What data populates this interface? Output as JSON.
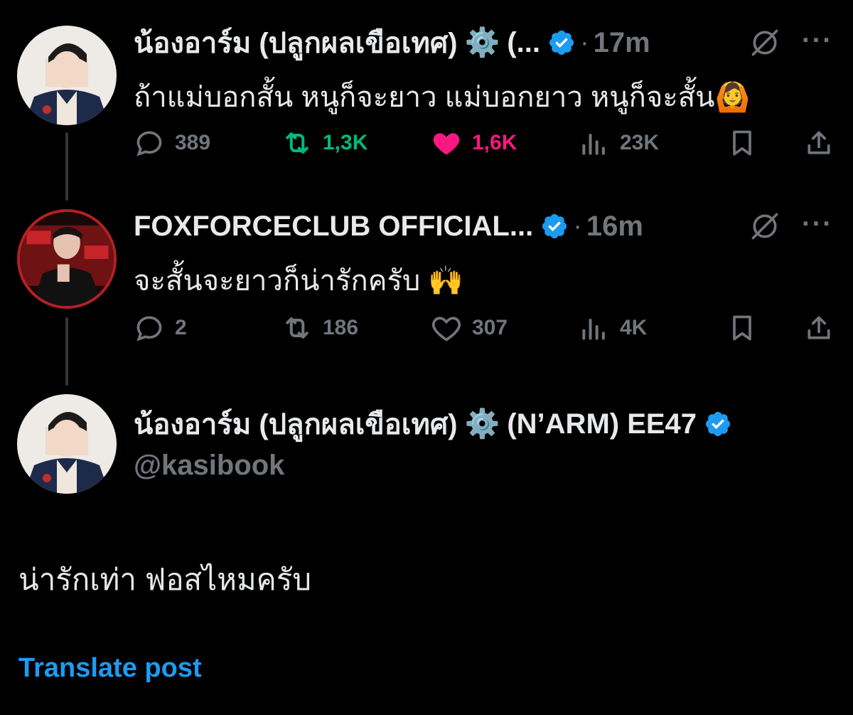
{
  "colors": {
    "background": "#000000",
    "text": "#e7e9ea",
    "muted": "#71767b",
    "retweet_active": "#00ba7c",
    "like_active": "#f91880",
    "verified": "#1d9bf0",
    "link": "#1d9bf0"
  },
  "posts": [
    {
      "author_name": "น้องอาร์ม (ปลูกผลเขือเทศ)",
      "author_suffix": "(...",
      "gear_glyph": "⚙️",
      "verified": true,
      "time": "17m",
      "text": "ถ้าแม่บอกสั้น หนูก็จะยาว แม่บอกยาว หนูก็จะสั้น🙆",
      "stats": {
        "replies": "389",
        "reposts": "1,3K",
        "likes": "1,6K",
        "views": "23K"
      },
      "reposted": true,
      "liked": true
    },
    {
      "author_name": "FOXFORCECLUB OFFICIAL...",
      "verified": true,
      "time": "16m",
      "text": "จะสั้นจะยาวก็น่ารักครับ 🙌",
      "stats": {
        "replies": "2",
        "reposts": "186",
        "likes": "307",
        "views": "4K"
      },
      "reposted": false,
      "liked": false
    }
  ],
  "main_post": {
    "author_name": "น้องอาร์ม (ปลูกผลเขือเทศ)",
    "gear_glyph": "⚙️",
    "author_suffix": "(N’ARM) EE47",
    "verified": true,
    "handle": "@kasibook",
    "text": "น่ารักเท่า ฟอสไหมครับ",
    "translate_label": "Translate post"
  },
  "separator": "·",
  "more_glyph": "···",
  "icons": {
    "reply": "reply-icon",
    "repost": "repost-icon",
    "like": "heart-icon",
    "views": "views-icon",
    "bookmark": "bookmark-icon",
    "share": "share-icon",
    "grok": "grok-icon",
    "verified": "verified-badge-icon"
  }
}
